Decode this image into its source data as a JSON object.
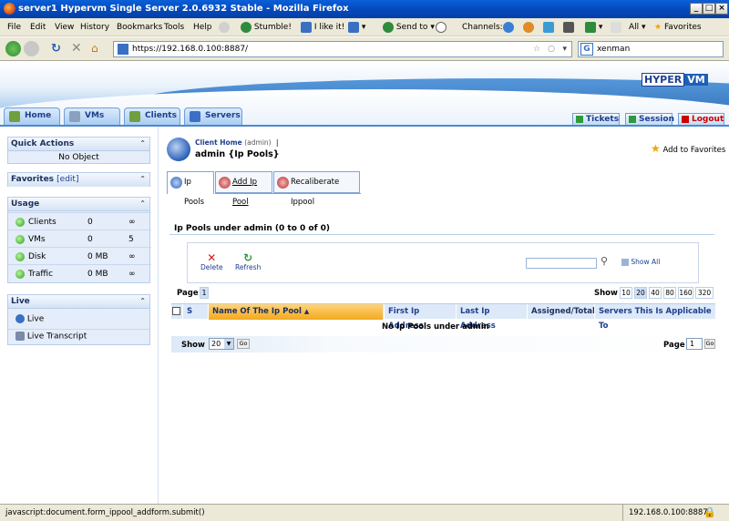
{
  "window": {
    "title": "server1 Hypervm Single Server 2.0.6932 Stable - Mozilla Firefox"
  },
  "menu": [
    "File",
    "Edit",
    "View",
    "History",
    "Bookmarks",
    "Tools",
    "Help"
  ],
  "toolbar": {
    "stumble": "Stumble!",
    "like": "I like it!",
    "send": "Send to",
    "channels": "Channels:",
    "all": "All",
    "favorites": "Favorites"
  },
  "nav": {
    "url": "https://192.168.0.100:8887/",
    "search_value": "xenman"
  },
  "logo": {
    "left": "HYPER",
    "right": "VM"
  },
  "tabs": [
    "Home",
    "VMs",
    "Clients",
    "Servers"
  ],
  "right_tabs": [
    "Tickets",
    "Session",
    "Logout"
  ],
  "left": {
    "quick_actions": {
      "title": "Quick Actions",
      "empty": "No Object"
    },
    "favorites": {
      "title": "Favorites",
      "edit": "[edit]"
    },
    "usage": {
      "title": "Usage",
      "rows": [
        {
          "label": "Clients",
          "value": "0",
          "max": "∞"
        },
        {
          "label": "VMs",
          "value": "0",
          "max": "5"
        },
        {
          "label": "Disk",
          "value": "0 MB",
          "max": "∞"
        },
        {
          "label": "Traffic",
          "value": "0 MB",
          "max": "∞"
        }
      ]
    },
    "live": {
      "title": "Live",
      "items": [
        "Live",
        "Live Transcript"
      ]
    }
  },
  "main": {
    "client_home": "Client Home",
    "client_home_sub": "(admin)",
    "title": "admin {Ip Pools}",
    "add_fav": "Add to Favorites",
    "subtabs": [
      "Ip Pools",
      "Add Ip Pool",
      "Recaliberate Ippool"
    ],
    "pools_heading": "Ip Pools under admin (0 to 0 of 0)",
    "delete": "Delete",
    "refresh": "Refresh",
    "show_all": "Show All",
    "page_label": "Page",
    "page_num": "1",
    "show_label": "Show",
    "show_options": [
      "10",
      "20",
      "40",
      "80",
      "160",
      "320"
    ],
    "columns": [
      "S",
      "Name Of The Ip Pool",
      "First Ip Address",
      "Last Ip Address",
      "Assigned/Total",
      "Servers This Is Applicable To"
    ],
    "empty": "No Ip Pools under admin",
    "footer_show": "Show",
    "footer_show_val": "20",
    "go": "Go",
    "footer_page": "Page",
    "footer_page_val": "1"
  },
  "status": {
    "left": "javascript:document.form_ippool_addform.submit()",
    "right": "192.168.0.100:8887"
  }
}
